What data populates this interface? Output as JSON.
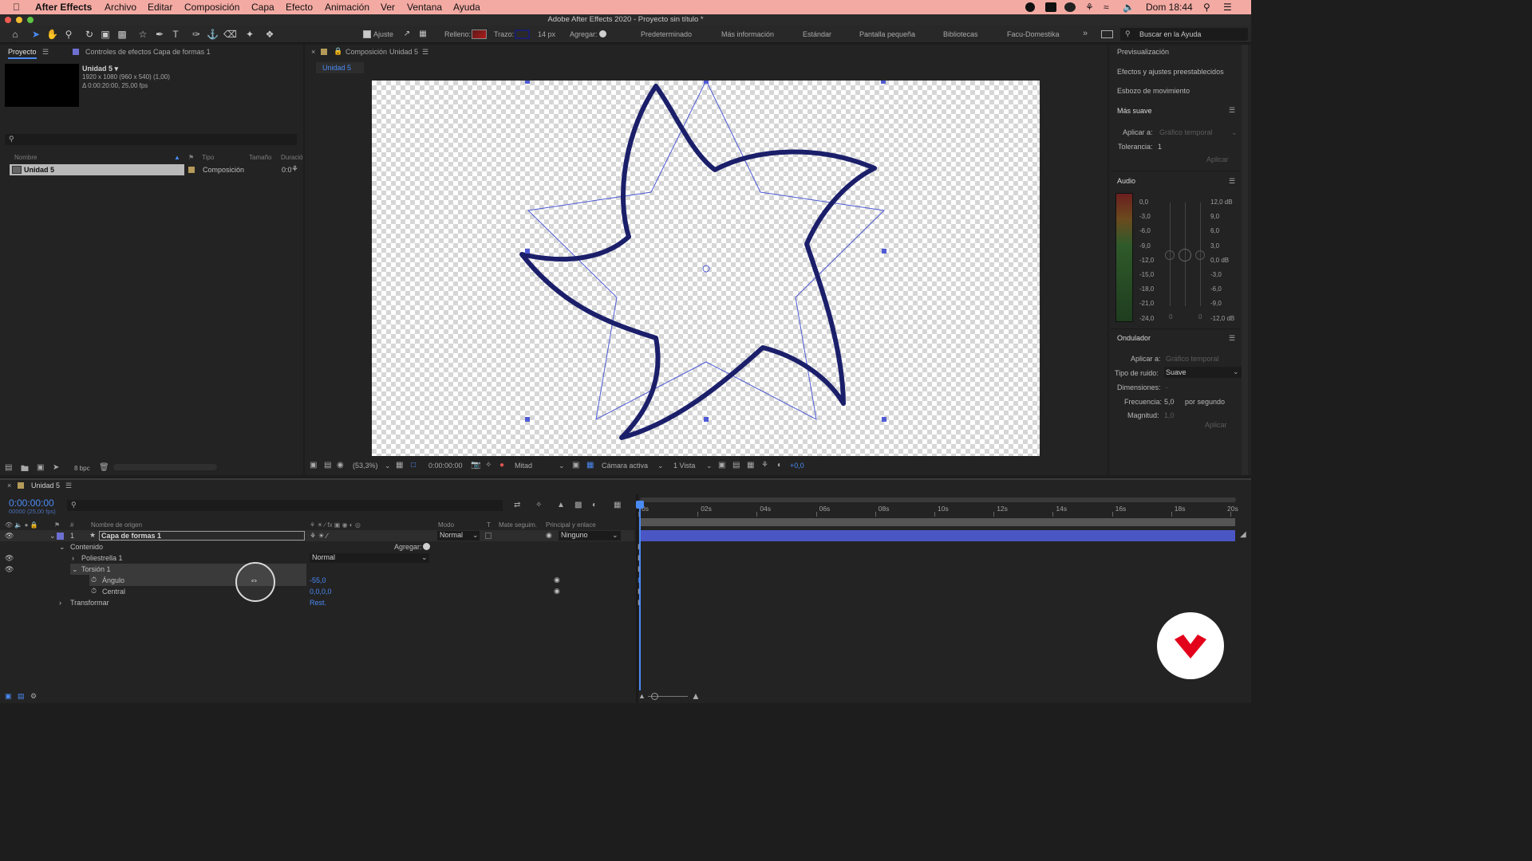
{
  "menubar": {
    "app_name": "After Effects",
    "items": [
      "Archivo",
      "Editar",
      "Composición",
      "Capa",
      "Efecto",
      "Animación",
      "Ver",
      "Ventana",
      "Ayuda"
    ],
    "clock": "Dom 18:44"
  },
  "window": {
    "title": "Adobe After Effects 2020 - Proyecto sin título *"
  },
  "toolbar": {
    "ajuste_label": "Ajuste",
    "relleno_label": "Relleno:",
    "trazo_label": "Trazo:",
    "stroke_width": "14 px",
    "agregar_label": "Agregar:",
    "workspaces": [
      "Predeterminado",
      "Más información",
      "Estándar",
      "Pantalla pequeña",
      "Bibliotecas",
      "Facu-Domestika"
    ],
    "search_placeholder": "Buscar en la Ayuda"
  },
  "project": {
    "tab_label": "Proyecto",
    "effects_tab": "Controles de efectos Capa de formas 1",
    "item_name": "Unidad 5 ▾",
    "item_info_1": "1920 x 1080  (960 x 540) (1,00)",
    "item_info_2": "Δ 0:00:20:00, 25,00 fps",
    "columns": {
      "name": "Nombre",
      "type": "Tipo",
      "size": "Tamaño",
      "duration": "Duració"
    },
    "row": {
      "name": "Unidad 5",
      "type": "Composición",
      "duration": "0:0"
    },
    "bpc": "8 bpc"
  },
  "composition": {
    "tab_prefix": "Composición",
    "tab_name": "Unidad 5",
    "subtab": "Unidad 5",
    "zoom": "(53,3%)",
    "timecode": "0:00:00:00",
    "resolution": "Mitad",
    "camera": "Cámara activa",
    "views": "1 Vista",
    "exposure": "+0,0"
  },
  "right_panel": {
    "items": [
      "Previsualización",
      "Efectos y ajustes preestablecidos",
      "Esbozo de movimiento"
    ],
    "smoother": {
      "title": "Más suave",
      "apply_to_label": "Aplicar a:",
      "apply_to_value": "Gráfico temporal",
      "tolerance_label": "Tolerancia:",
      "tolerance_value": "1",
      "apply_button": "Aplicar"
    },
    "audio": {
      "title": "Audio",
      "left_scale": [
        "0,0",
        "-3,0",
        "-6,0",
        "-9,0",
        "-12,0",
        "-15,0",
        "-18,0",
        "-21,0",
        "-24,0"
      ],
      "right_scale": [
        "12,0 dB",
        "9,0",
        "6,0",
        "3,0",
        "0,0 dB",
        "-3,0",
        "-6,0",
        "-9,0",
        "-12,0 dB"
      ],
      "bottom_left": "0",
      "bottom_right": "0"
    },
    "wiggler": {
      "title": "Ondulador",
      "apply_to_label": "Aplicar a:",
      "apply_to_value": "Gráfico temporal",
      "noise_label": "Tipo de ruido:",
      "noise_value": "Suave",
      "dims_label": "Dimensiones:",
      "dims_value": "-",
      "freq_label": "Frecuencia:",
      "freq_value": "5,0",
      "freq_unit": "por segundo",
      "mag_label": "Magnitud:",
      "mag_value": "1,0",
      "apply_button": "Aplicar"
    }
  },
  "timeline": {
    "tab_label": "Unidad 5",
    "timecode": "0:00:00:00",
    "frames": "00000 (25,00 fps)",
    "headers": {
      "source": "Nombre de origen",
      "mode": "Modo",
      "t": "T",
      "track_matte": "Mate seguim.",
      "parent": "Principal y enlace"
    },
    "layer": {
      "number": "1",
      "name": "Capa de formas 1",
      "mode": "Normal",
      "parent": "Ninguno"
    },
    "contents_label": "Contenido",
    "add_label": "Agregar:",
    "polystar": "Poliestrella 1",
    "polystar_mode": "Normal",
    "twist": "Torsión 1",
    "angle_label": "Ángulo",
    "angle_value": "-55,0",
    "center_label": "Central",
    "center_value": "0,0,0,0",
    "transform_label": "Transformar",
    "reset_label": "Rest.",
    "ruler": [
      "0s",
      "02s",
      "04s",
      "06s",
      "08s",
      "10s",
      "12s",
      "14s",
      "16s",
      "18s",
      "20s"
    ]
  },
  "colors": {
    "menubar_bg": "#f3aaa3",
    "accent_blue": "#4a8af4",
    "shape_stroke": "#1b1f6a",
    "guide_blue": "#4f5bd5",
    "layer_bar": "#4a56c3",
    "logo_red": "#e3001b"
  }
}
